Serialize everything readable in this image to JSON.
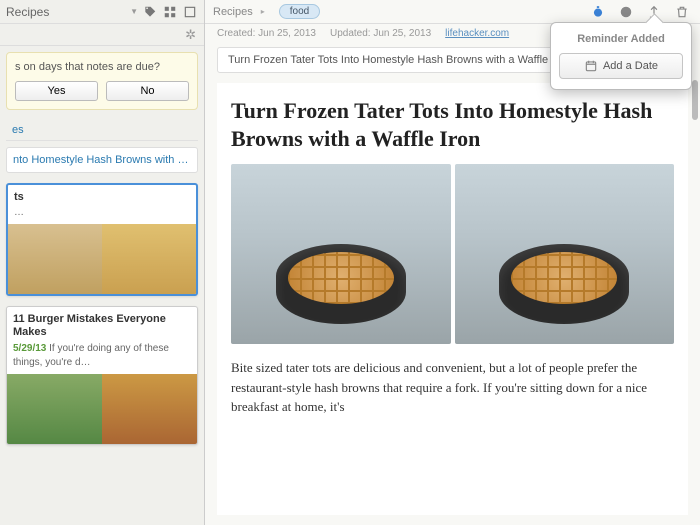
{
  "sidebar": {
    "title": "Recipes",
    "prompt": {
      "question": "s on days that notes are due?",
      "yes": "Yes",
      "no": "No"
    },
    "top_link": "es",
    "note_link": "nto Homestyle Hash Browns with a Waffle Iron",
    "cards": [
      {
        "title": "ts",
        "date": "",
        "snippet": "…"
      },
      {
        "title": "11 Burger Mistakes Everyone Makes",
        "date": "5/29/13",
        "snippet": " If you're doing any of these things, you're d…"
      }
    ]
  },
  "toolbar": {
    "crumb": "Recipes",
    "tag": "food"
  },
  "meta": {
    "created_label": "Created:",
    "created": "Jun 25, 2013",
    "updated_label": "Updated:",
    "updated": "Jun 25, 2013",
    "source": "lifehacker.com"
  },
  "note": {
    "title_bar": "Turn Frozen Tater Tots Into Homestyle Hash Browns with a Waffle Iro",
    "heading": "Turn Frozen Tater Tots Into Homestyle Hash Browns with a Waffle Iron",
    "body": "Bite sized tater tots are delicious and convenient, but a lot of people prefer the restaurant-style hash browns that require a fork. If you're sitting down for a nice breakfast at home, it's"
  },
  "popover": {
    "title": "Reminder Added",
    "button": "Add a Date"
  }
}
